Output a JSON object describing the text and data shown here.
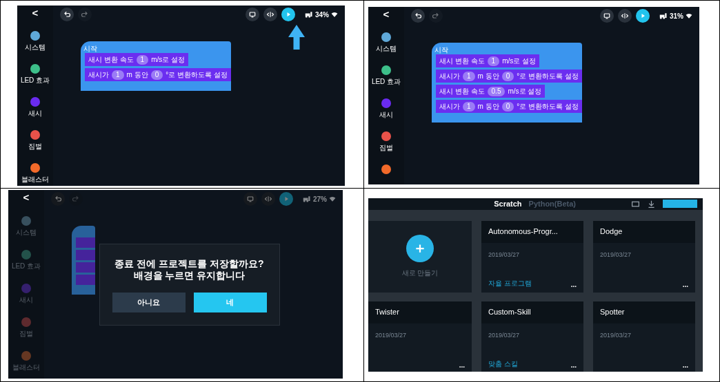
{
  "panels": [
    {
      "kind": "editor",
      "dimmed": false,
      "pointer_arrow": true,
      "back": "<",
      "undo": {
        "disabled": false
      },
      "redo": {
        "disabled": true
      },
      "battery": "34%",
      "sidebar": [
        {
          "label": "시스템",
          "color": "#5fa8d8"
        },
        {
          "label": "LED 효과",
          "color": "#3dbf8a"
        },
        {
          "label": "새시",
          "color": "#6a2bf0"
        },
        {
          "label": "짐벌",
          "color": "#e8524a"
        },
        {
          "label": "블래스터",
          "color": "#f26a2a"
        }
      ],
      "script": {
        "hat": "시작",
        "statements": [
          {
            "kind": "text",
            "parts": [
              {
                "kind": "text",
                "text": "새시 변환 속도"
              },
              {
                "kind": "input",
                "text": "1"
              },
              {
                "kind": "text",
                "text": "m/s로 설정"
              }
            ]
          },
          {
            "kind": "text",
            "parts": [
              {
                "kind": "text",
                "text": "새시가"
              },
              {
                "kind": "input",
                "text": "1"
              },
              {
                "kind": "text",
                "text": "m 동안"
              },
              {
                "kind": "input",
                "text": "0"
              },
              {
                "kind": "text",
                "text": "°로 변환하도록 설정"
              }
            ]
          }
        ]
      }
    },
    {
      "kind": "editor",
      "dimmed": false,
      "pointer_arrow": false,
      "back": "<",
      "undo": {
        "disabled": false
      },
      "redo": {
        "disabled": true
      },
      "battery": "31%",
      "sidebar": [
        {
          "label": "시스템",
          "color": "#5fa8d8"
        },
        {
          "label": "LED 효과",
          "color": "#3dbf8a"
        },
        {
          "label": "새시",
          "color": "#6a2bf0"
        },
        {
          "label": "짐벌",
          "color": "#e8524a"
        },
        {
          "color": "#f26a2a"
        }
      ],
      "script": {
        "hat": "시작",
        "statements": [
          {
            "kind": "text",
            "parts": [
              {
                "kind": "text",
                "text": "새시 변환 속도"
              },
              {
                "kind": "input",
                "text": "1"
              },
              {
                "kind": "text",
                "text": "m/s로 설정"
              }
            ]
          },
          {
            "kind": "text",
            "parts": [
              {
                "kind": "text",
                "text": "새시가"
              },
              {
                "kind": "input",
                "text": "1"
              },
              {
                "kind": "text",
                "text": "m 동안"
              },
              {
                "kind": "input",
                "text": "0"
              },
              {
                "kind": "text",
                "text": "°로 변환하도록 설정"
              }
            ]
          },
          {
            "kind": "text",
            "parts": [
              {
                "kind": "text",
                "text": "새시 변환 속도"
              },
              {
                "kind": "input",
                "text": "0.5"
              },
              {
                "kind": "text",
                "text": "m/s로 설정"
              }
            ]
          },
          {
            "kind": "text",
            "parts": [
              {
                "kind": "text",
                "text": "새시가"
              },
              {
                "kind": "input",
                "text": "1"
              },
              {
                "kind": "text",
                "text": "m 동안"
              },
              {
                "kind": "input",
                "text": "0"
              },
              {
                "kind": "text",
                "text": "°로 변환하도록 설정"
              }
            ]
          }
        ]
      }
    },
    {
      "kind": "editor",
      "dimmed": true,
      "pointer_arrow": false,
      "back": "<",
      "undo": {
        "disabled": false
      },
      "redo": {
        "disabled": true
      },
      "battery": "27%",
      "sidebar": [
        {
          "label": "시스템",
          "color": "#38505e"
        },
        {
          "label": "LED 효과",
          "color": "#23524a"
        },
        {
          "label": "새시",
          "color": "#35206e"
        },
        {
          "label": "짐벌",
          "color": "#5e2a2e"
        },
        {
          "label": "블래스터",
          "color": "#653722"
        }
      ],
      "script": {
        "statements": [
          {
            "kind": "covered"
          },
          {
            "kind": "covered"
          },
          {
            "kind": "covered"
          },
          {
            "kind": "covered"
          }
        ]
      },
      "dialog": {
        "message": "종료 전에 프로젝트를 저장할까요? 배경을 누르면 유지합니다",
        "buttons": [
          {
            "label": "아니요",
            "primary": false
          },
          {
            "label": "네",
            "primary": true
          }
        ]
      }
    },
    {
      "kind": "projects",
      "tabs": [
        {
          "label": "Scratch",
          "selected": true
        },
        {
          "label": "Python(Beta)",
          "selected": false
        }
      ],
      "cards": [
        {
          "kind": "new",
          "label": "새로 만들기"
        },
        {
          "kind": "project",
          "title": "Autonomous-Progr...",
          "date": "2019/03/27",
          "tag": "자율 프로그램",
          "menu": "..."
        },
        {
          "kind": "project",
          "title": "Dodge",
          "date": "2019/03/27",
          "menu": "..."
        },
        {
          "kind": "project",
          "title": "Twister",
          "date": "2019/03/27",
          "menu": "..."
        },
        {
          "kind": "project",
          "title": "Custom-Skill",
          "date": "2019/03/27",
          "tag": "맞춤 스킬",
          "menu": "..."
        },
        {
          "kind": "project",
          "title": "Spotter",
          "date": "2019/03/27",
          "menu": "..."
        }
      ]
    }
  ]
}
